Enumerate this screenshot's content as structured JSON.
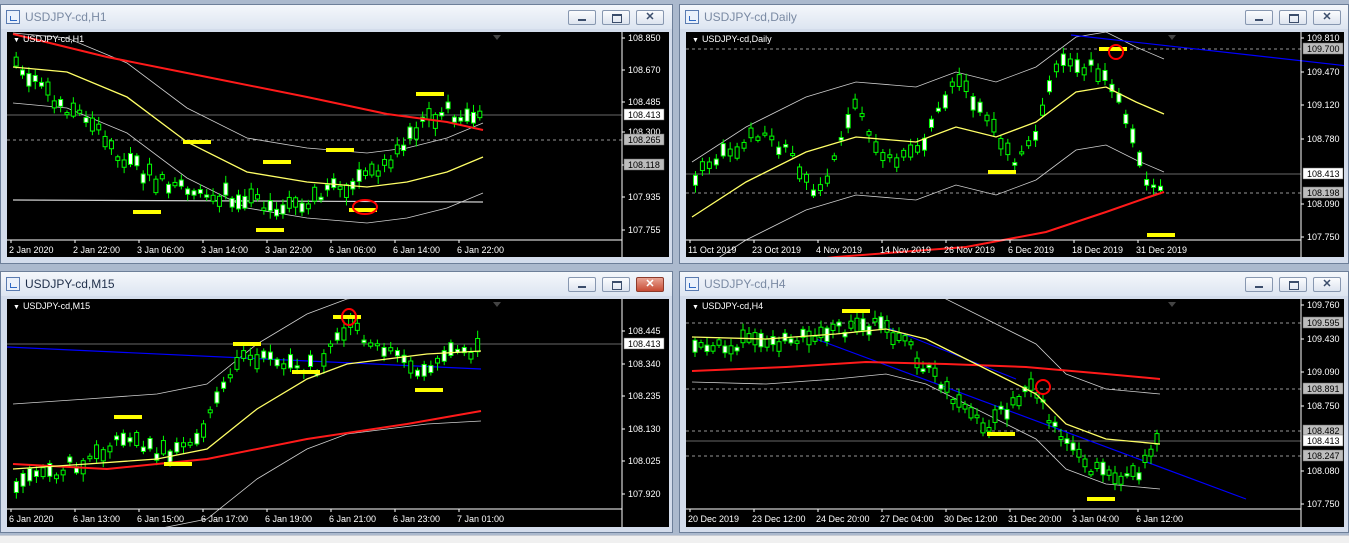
{
  "windows": [
    {
      "id": "h1",
      "title": "USDJPY-cd,H1",
      "chart_label": "USDJPY-cd,H1",
      "active": false,
      "price_labels": [
        "108.850",
        "108.670",
        "108.485",
        "108.300",
        "108.118",
        "107.935",
        "107.755"
      ],
      "highlight_prices": [
        "108.413",
        "108.265",
        "108.118"
      ],
      "time_labels": [
        "2 Jan 2020",
        "2 Jan 22:00",
        "3 Jan 06:00",
        "3 Jan 14:00",
        "3 Jan 22:00",
        "6 Jan 06:00",
        "6 Jan 14:00",
        "6 Jan 22:00"
      ]
    },
    {
      "id": "daily",
      "title": "USDJPY-cd,Daily",
      "chart_label": "USDJPY-cd,Daily",
      "active": false,
      "price_labels": [
        "109.810",
        "109.470",
        "109.120",
        "108.780",
        "108.090",
        "107.750"
      ],
      "highlight_prices": [
        "109.700",
        "108.413",
        "108.198"
      ],
      "time_labels": [
        "11 Oct 2019",
        "23 Oct 2019",
        "4 Nov 2019",
        "14 Nov 2019",
        "26 Nov 2019",
        "6 Dec 2019",
        "18 Dec 2019",
        "31 Dec 2019"
      ]
    },
    {
      "id": "m15",
      "title": "USDJPY-cd,M15",
      "chart_label": "USDJPY-cd,M15",
      "active": true,
      "price_labels": [
        "108.445",
        "108.340",
        "108.235",
        "108.130",
        "108.025",
        "107.920"
      ],
      "highlight_prices": [
        "108.413"
      ],
      "time_labels": [
        "6 Jan 2020",
        "6 Jan 13:00",
        "6 Jan 15:00",
        "6 Jan 17:00",
        "6 Jan 19:00",
        "6 Jan 21:00",
        "6 Jan 23:00",
        "7 Jan 01:00"
      ]
    },
    {
      "id": "h4",
      "title": "USDJPY-cd,H4",
      "chart_label": "USDJPY-cd,H4",
      "active": false,
      "price_labels": [
        "109.760",
        "109.430",
        "109.090",
        "108.750",
        "108.080",
        "107.750"
      ],
      "highlight_prices": [
        "109.595",
        "108.891",
        "108.482",
        "108.413",
        "108.247"
      ],
      "time_labels": [
        "20 Dec 2019",
        "23 Dec 12:00",
        "24 Dec 20:00",
        "27 Dec 04:00",
        "30 Dec 12:00",
        "31 Dec 20:00",
        "3 Jan 04:00",
        "6 Jan 12:00"
      ]
    }
  ],
  "colors": {
    "chart_background": "#000000",
    "candle": "#00ff00",
    "candle_body": "#ffffff",
    "ma_fast": "#ffff66",
    "ma_slow": "#ff1a1a",
    "trendline": "#0000ff",
    "marker": "#ffff00",
    "circle": "#ff0000"
  }
}
